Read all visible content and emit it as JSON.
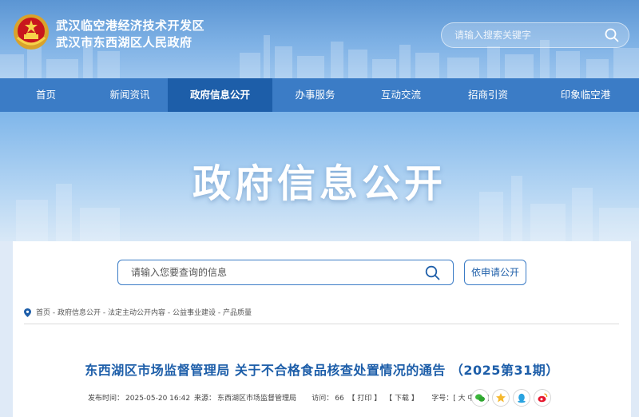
{
  "header": {
    "site_name_line1": "武汉临空港经济技术开发区",
    "site_name_line2": "武汉市东西湖区人民政府",
    "search_placeholder": "请输入搜索关键字",
    "emblem_icon": "national-emblem-icon",
    "search_icon": "search-icon"
  },
  "nav": {
    "items": [
      {
        "label": "首页"
      },
      {
        "label": "新闻资讯"
      },
      {
        "label": "政府信息公开",
        "active": true
      },
      {
        "label": "办事服务"
      },
      {
        "label": "互动交流"
      },
      {
        "label": "招商引资"
      },
      {
        "label": "印象临空港"
      }
    ]
  },
  "banner": {
    "title": "政府信息公开"
  },
  "info_search": {
    "placeholder": "请输入您要查询的信息",
    "apply_label": "依申请公开"
  },
  "breadcrumb": {
    "items": [
      "首页",
      "政府信息公开",
      "法定主动公开内容",
      "公益事业建设",
      "产品质量"
    ],
    "separator": " - "
  },
  "article": {
    "title": "东西湖区市场监督管理局 关于不合格食品核查处置情况的通告 （2025第31期）",
    "published_label": "发布时间：",
    "published": "2025-05-20 16:42",
    "source_label": "来源：",
    "source": "东西湖区市场监督管理局",
    "visits_label": "访问：",
    "visits": "66",
    "print_label": "【 打印 】",
    "download_label": "【 下载 】",
    "fontsize_label": "字号：[ 大 中 小 ]",
    "share_icons": [
      "wechat-icon",
      "qzone-icon",
      "qq-icon",
      "weibo-icon"
    ]
  },
  "colors": {
    "nav_bg": "#3b7cc6",
    "nav_active": "#1d5ea9",
    "title_blue": "#1d5ea9"
  }
}
